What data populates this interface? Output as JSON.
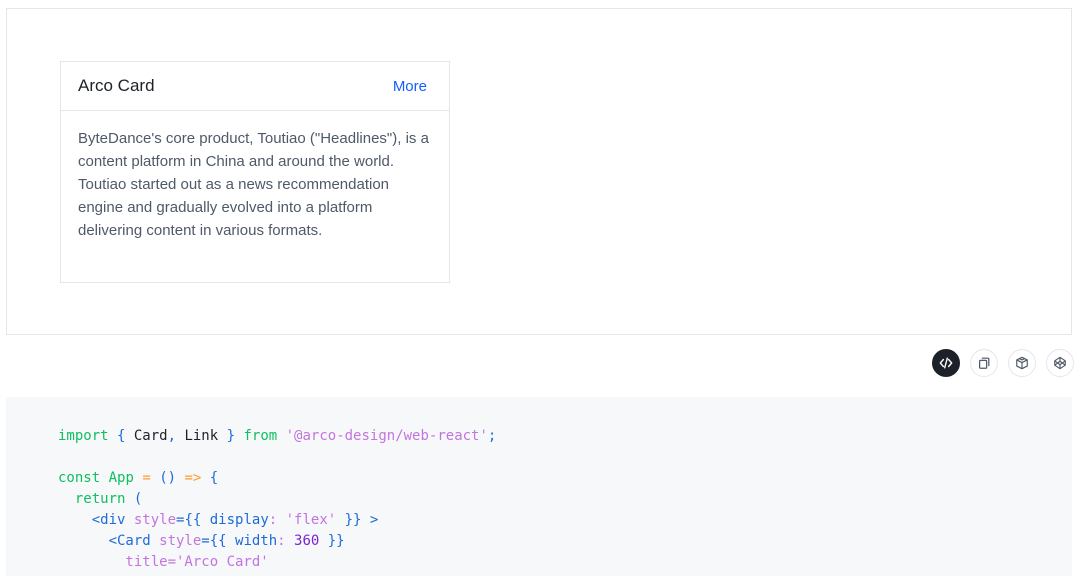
{
  "card": {
    "title": "Arco Card",
    "more_label": "More",
    "body": "ByteDance's core product, Toutiao (\"Headlines\"), is a content platform in China and around the world. Toutiao started out as a news recommendation engine and gradually evolved into a platform delivering content in various formats."
  },
  "toolbar": {
    "buttons": [
      {
        "name": "code-icon",
        "active": true
      },
      {
        "name": "copy-icon",
        "active": false
      },
      {
        "name": "codesandbox-icon",
        "active": false
      },
      {
        "name": "codepen-icon",
        "active": false
      }
    ]
  },
  "code": {
    "l1": {
      "a": "import",
      "b": " { ",
      "c": "Card",
      "d": ", ",
      "e": "Link",
      "f": " } ",
      "g": "from",
      "h": " ",
      "i": "'@arco-design/web-react'",
      "j": ";"
    },
    "l3": {
      "a": "const",
      "b": " ",
      "c": "App",
      "d": " = ",
      "e": "()",
      "f": " => ",
      "g": "{"
    },
    "l4": {
      "a": "  return",
      "b": " ("
    },
    "l5": {
      "a": "    <div",
      "b": " style",
      "c": "={{",
      "d": " display",
      "e": ":",
      "f": " 'flex'",
      "g": " }}",
      "h": " >"
    },
    "l6": {
      "a": "      <Card",
      "b": " style",
      "c": "={{",
      "d": " width",
      "e": ":",
      "f": " 360",
      "g": " }}"
    },
    "l7": {
      "a": "        title",
      "b": "='Arco Card'"
    }
  }
}
